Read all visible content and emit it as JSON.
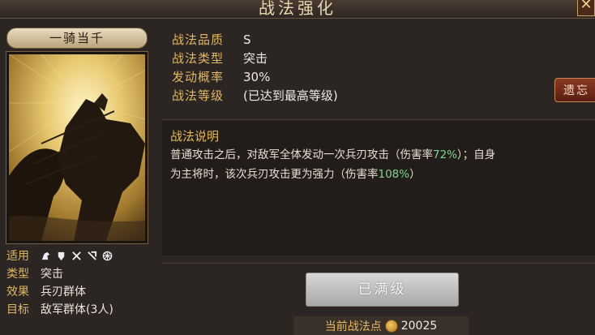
{
  "header": {
    "title": "战法强化",
    "close_glyph": "✕"
  },
  "card": {
    "name": "一骑当千",
    "attributes": [
      {
        "key": "适用",
        "value": ""
      },
      {
        "key": "类型",
        "value": "突击"
      },
      {
        "key": "效果",
        "value": "兵刃群体"
      },
      {
        "key": "目标",
        "value": "敌军群体(3人)"
      }
    ],
    "unit_icons": [
      "cavalry-icon",
      "shield-icon",
      "crossed-spears-icon",
      "bow-icon",
      "wheel-icon"
    ]
  },
  "info": {
    "rows": [
      {
        "key": "战法品质",
        "value": "S"
      },
      {
        "key": "战法类型",
        "value": "突击"
      },
      {
        "key": "发动概率",
        "value": "30%"
      },
      {
        "key": "战法等级",
        "value": "(已达到最高等级)"
      }
    ],
    "legacy_button_label": "遗忘"
  },
  "description": {
    "title": "战法说明",
    "line1_a": "普通攻击之后，对敌军全体发动一次兵刃攻击（伤害率",
    "line1_hl": "72%",
    "line1_b": "）；自身",
    "line2_a": "为主将时，该次兵刃攻击更为强力（伤害率",
    "line2_hl": "108%",
    "line2_b": "）"
  },
  "action": {
    "maxed_label": "已满级"
  },
  "points": {
    "label": "当前战法点",
    "value": "20025"
  },
  "colors": {
    "accent_gold": "#e4b860",
    "highlight_green": "#7fd88a",
    "danger_red": "#8a3a22"
  }
}
